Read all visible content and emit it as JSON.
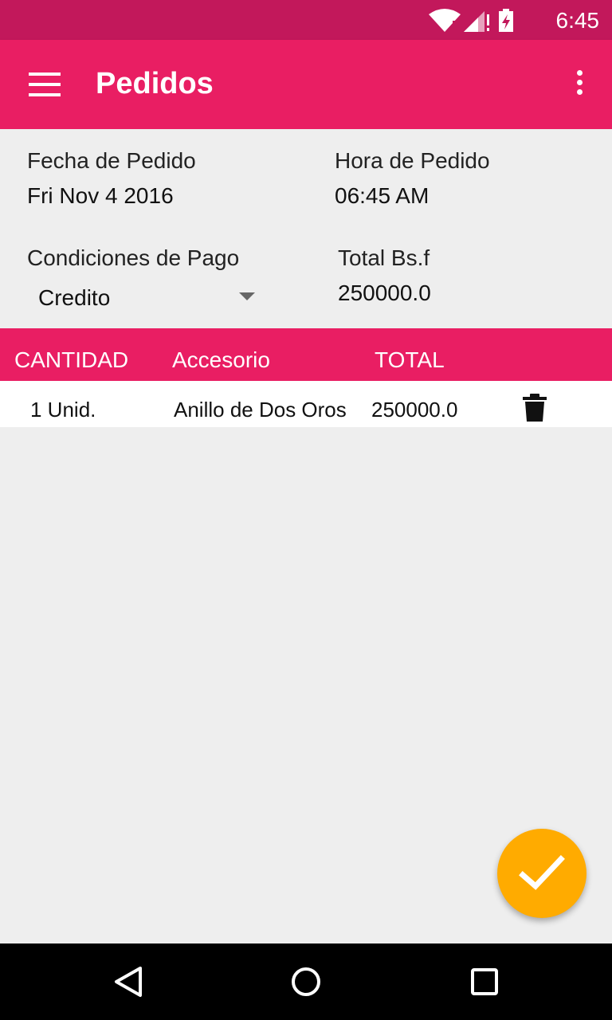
{
  "status_bar": {
    "time": "6:45",
    "icons": [
      "wifi-icon",
      "signal-icon",
      "battery-icon"
    ]
  },
  "app_bar": {
    "title": "Pedidos",
    "icons": [
      "menu-icon",
      "overflow-menu-icon"
    ],
    "color": "#e91e63"
  },
  "order": {
    "date_label": "Fecha de Pedido",
    "date_value": "Fri Nov 4 2016",
    "time_label": "Hora de Pedido",
    "time_value": "06:45 AM",
    "payment_label": "Condiciones de Pago",
    "payment_value": "Credito",
    "total_label": "Total Bs.f",
    "total_value": "250000.0"
  },
  "table": {
    "headers": [
      "CANTIDAD",
      "Accesorio",
      "TOTAL"
    ],
    "rows": [
      {
        "quantity": "1 Unid.",
        "item": "Anillo de Dos Oros",
        "total": "250000.0"
      }
    ]
  },
  "fab": {
    "icon": "check-icon",
    "color": "#ffab00"
  },
  "nav_bar": {
    "icons": [
      "back-icon",
      "home-icon",
      "recents-icon"
    ]
  }
}
